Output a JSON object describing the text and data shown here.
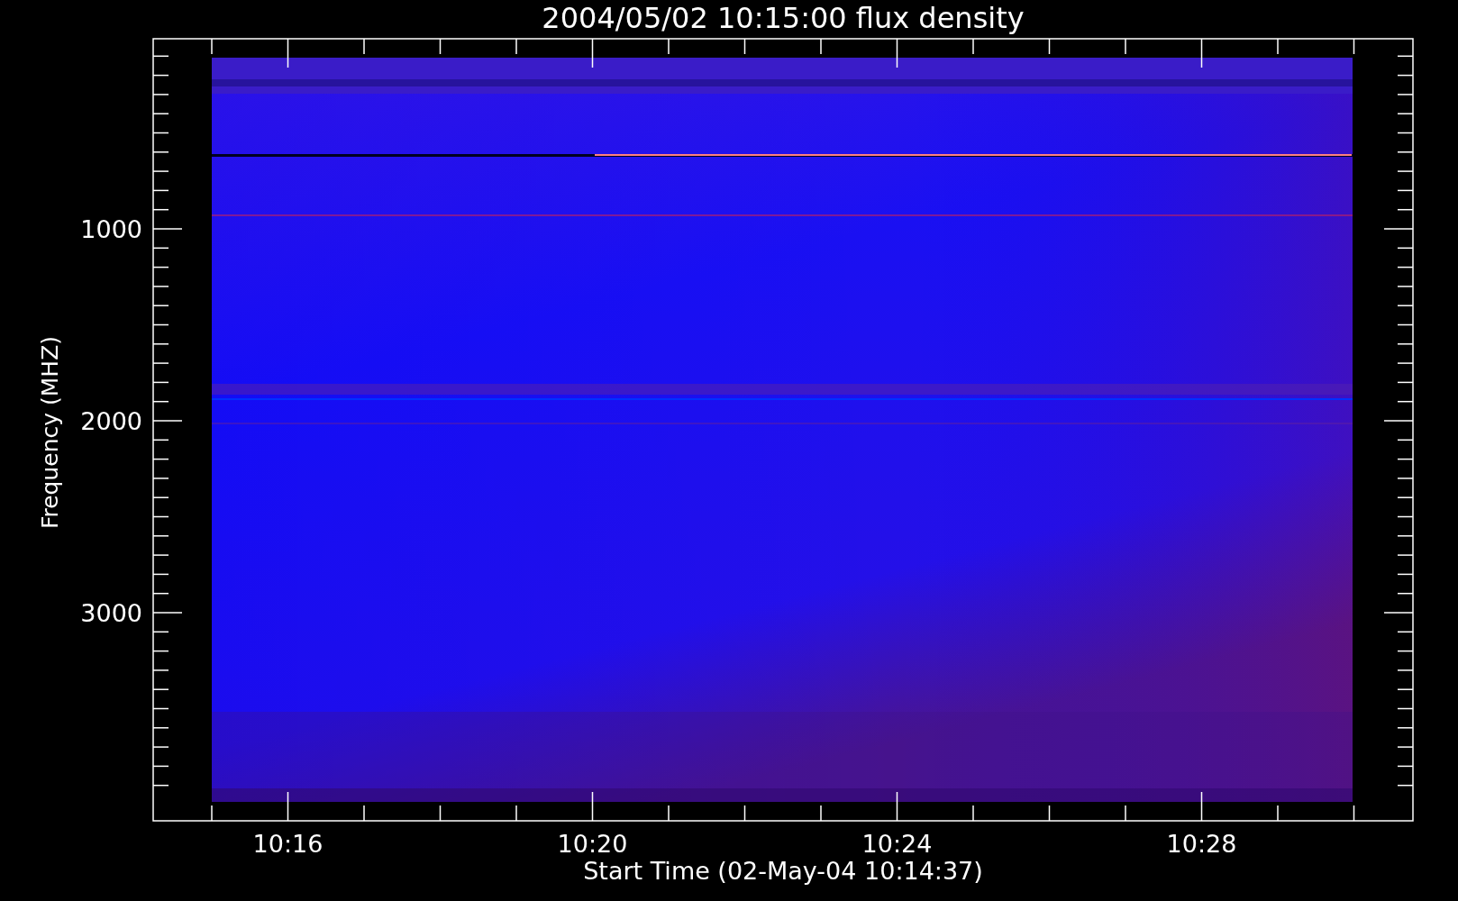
{
  "plot": {
    "title": "2004/05/02 10:15:00 flux density",
    "xlabel": "Start Time (02-May-04 10:14:37)",
    "ylabel": "Frequency (MHZ)",
    "xticks": [
      "10:16",
      "10:20",
      "10:24",
      "10:28"
    ],
    "yticks": [
      "1000",
      "2000",
      "3000"
    ]
  }
}
